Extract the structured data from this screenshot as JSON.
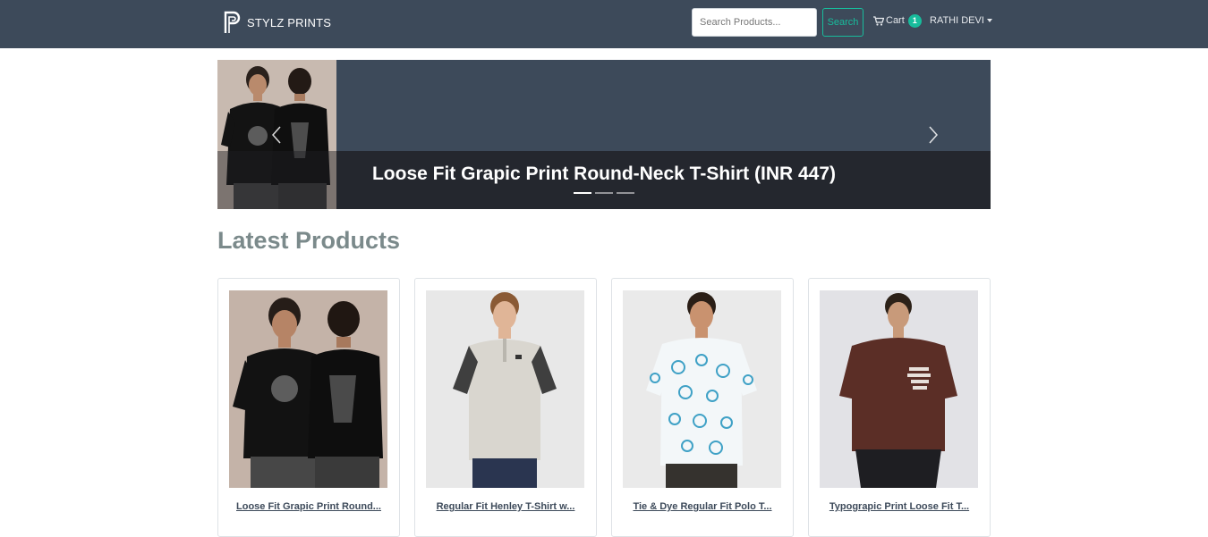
{
  "navbar": {
    "brand_name": "STYLZ PRINTS",
    "search_placeholder": "Search Products...",
    "search_button": "Search",
    "cart_label": "Cart",
    "cart_count": "1",
    "user_name": "RATHI DEVI"
  },
  "carousel": {
    "caption": "Loose Fit Grapic Print Round-Neck T-Shirt (INR 447)",
    "slide_count": 3,
    "active_index": 0
  },
  "latest": {
    "title": "Latest Products",
    "products": [
      {
        "title": "Loose Fit Grapic Print Round..."
      },
      {
        "title": "Regular Fit Henley T-Shirt w..."
      },
      {
        "title": "Tie & Dye Regular Fit Polo T..."
      },
      {
        "title": "Typograpic Print Loose Fit T..."
      }
    ]
  },
  "colors": {
    "navbar_bg": "#3d4a5a",
    "accent": "#18bc9c",
    "heading_gray": "#7b8a8b"
  },
  "icons": [
    "brand-logo-icon",
    "cart-icon",
    "chevron-left-icon",
    "chevron-right-icon"
  ]
}
